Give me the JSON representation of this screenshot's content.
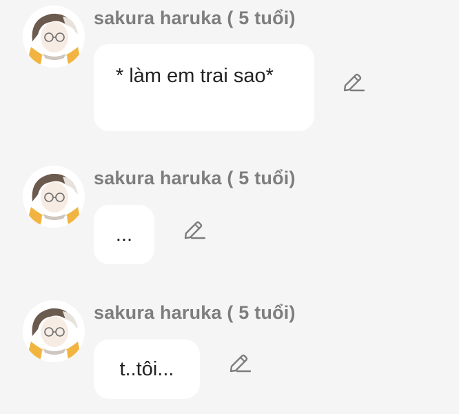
{
  "messages": [
    {
      "sender": "sakura haruka ( 5 tuổi)",
      "text": "* làm em trai sao*",
      "avatar_icon": "avatar-icon",
      "edit_icon": "pencil-icon"
    },
    {
      "sender": "sakura haruka ( 5 tuổi)",
      "text": "...",
      "avatar_icon": "avatar-icon",
      "edit_icon": "pencil-icon"
    },
    {
      "sender": "sakura haruka ( 5 tuổi)",
      "text": "t..tôi...",
      "avatar_icon": "avatar-icon",
      "edit_icon": "pencil-icon"
    }
  ],
  "colors": {
    "background": "#f5f5f5",
    "bubble": "#ffffff",
    "sender_text": "#7d7d7d",
    "message_text": "#222222",
    "edit_icon": "#7d7d7d",
    "avatar_accent": "#f2b441"
  }
}
